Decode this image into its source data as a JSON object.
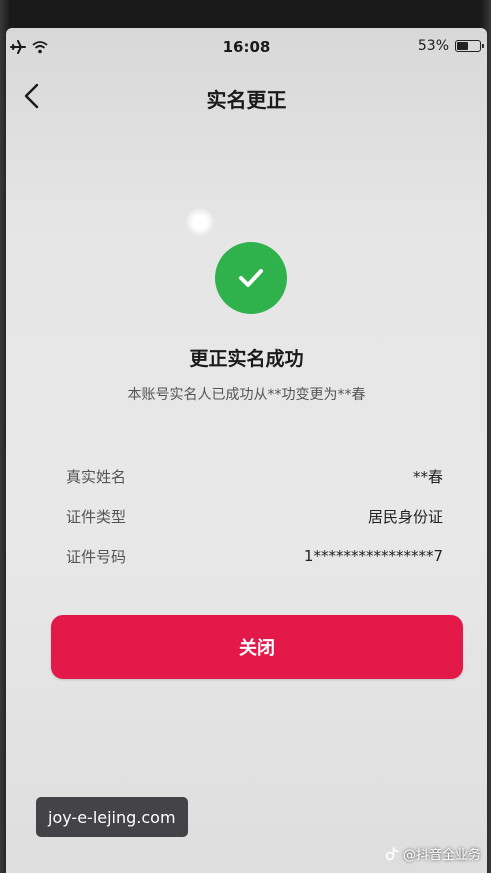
{
  "status_bar": {
    "time": "16:08",
    "battery_percent": "53%",
    "battery_level": 0.53
  },
  "nav": {
    "title": "实名更正"
  },
  "result": {
    "title": "更正实名成功",
    "description": "本账号实名人已成功从**功变更为**春",
    "status_color": "#2fb24c"
  },
  "info": [
    {
      "label": "真实姓名",
      "value": "**春"
    },
    {
      "label": "证件类型",
      "value": "居民身份证"
    },
    {
      "label": "证件号码",
      "value": "1****************7"
    }
  ],
  "actions": {
    "close_label": "关闭",
    "close_color": "#e3194a"
  },
  "watermarks": {
    "site": "joy-e-lejing.com",
    "author": "@抖音全业务"
  },
  "icons": {
    "airplane": "airplane-icon",
    "wifi": "wifi-icon",
    "battery": "battery-icon",
    "back": "chevron-left-icon",
    "success": "checkmark-icon"
  }
}
